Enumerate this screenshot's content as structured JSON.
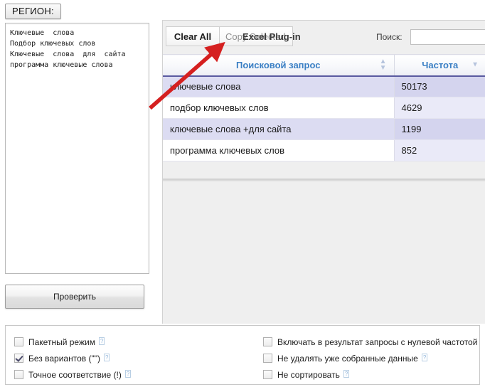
{
  "left": {
    "region_button_label": "РЕГИОН:",
    "keywords_text": "Ключевые  слова\nПодбор ключевых слов\nКлючевые  слова  для  сайта\nпрограмма ключевые слова",
    "check_button_label": "Проверить"
  },
  "toolbar": {
    "clear_all_label": "Clear All",
    "copy_selected_label": "Copy Selected",
    "excel_plugin_label": "Excel Plug-in",
    "search_label": "Поиск:",
    "search_value": "",
    "search_placeholder": ""
  },
  "table": {
    "columns": [
      {
        "label": "Поисковой запрос",
        "sort": "both"
      },
      {
        "label": "Частота",
        "sort": "desc"
      }
    ],
    "rows": [
      {
        "query": "ключевые слова",
        "freq": "50173"
      },
      {
        "query": "подбор ключевых слов",
        "freq": "4629"
      },
      {
        "query": "ключевые слова +для сайта",
        "freq": "1199"
      },
      {
        "query": "программа ключевых слов",
        "freq": "852"
      }
    ]
  },
  "options": {
    "left": [
      {
        "label": "Пакетный режим",
        "checked": false,
        "help": "?"
      },
      {
        "label": "Без вариантов (\"\")",
        "checked": true,
        "help": "?"
      },
      {
        "label": "Точное соответствие (!)",
        "checked": false,
        "help": "?"
      }
    ],
    "right": [
      {
        "label": "Включать в результат запросы с нулевой частотой",
        "checked": false,
        "help": ""
      },
      {
        "label": "Не удалять уже собранные данные",
        "checked": false,
        "help": "?"
      },
      {
        "label": "Не сортировать",
        "checked": false,
        "help": "?"
      }
    ]
  },
  "annotation": {
    "arrow_color": "#d52020"
  }
}
